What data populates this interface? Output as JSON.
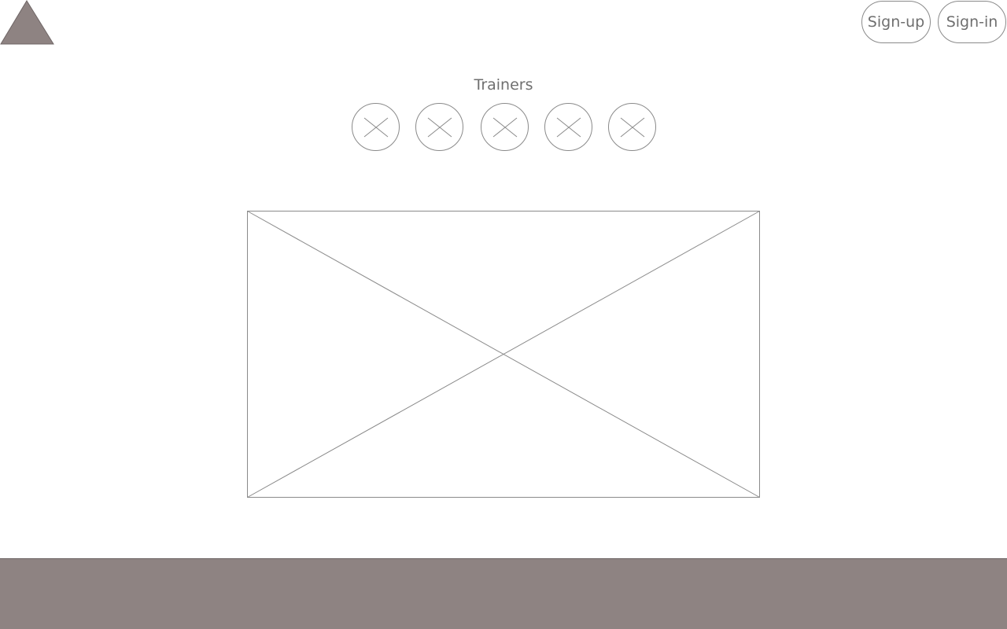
{
  "header": {
    "logo_icon": "triangle-logo-icon",
    "signup_label": "Sign-up",
    "signin_label": "Sign-in"
  },
  "trainers": {
    "title": "Trainers",
    "items": [
      {
        "icon": "image-placeholder-icon"
      },
      {
        "icon": "image-placeholder-icon"
      },
      {
        "icon": "image-placeholder-icon"
      },
      {
        "icon": "image-placeholder-icon"
      },
      {
        "icon": "image-placeholder-icon"
      }
    ]
  },
  "hero": {
    "icon": "image-placeholder-icon"
  },
  "colors": {
    "logo_fill": "#8e8382",
    "footer_fill": "#8e8382",
    "outline": "#8a8a8a",
    "text": "#6f6f6f"
  }
}
